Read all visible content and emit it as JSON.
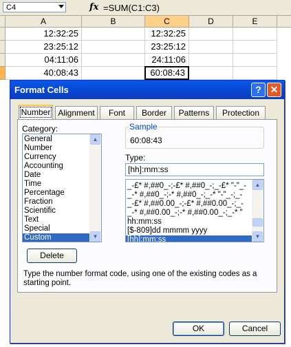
{
  "formula_bar": {
    "name_box": "C4",
    "fx_label": "fx",
    "formula": "=SUM(C1:C3)"
  },
  "sheet": {
    "columns": [
      "A",
      "B",
      "C",
      "D",
      "E"
    ],
    "rows": [
      {
        "A": "12:32:25",
        "C": "12:32:25"
      },
      {
        "A": "23:25:12",
        "C": "23:25:12"
      },
      {
        "A": "04:11:06",
        "C": "24:11:06"
      },
      {
        "A": "40:08:43",
        "C": "60:08:43"
      }
    ]
  },
  "dialog": {
    "title": "Format Cells",
    "help_button": "?",
    "close_button": "✕",
    "tabs": [
      "Number",
      "Alignment",
      "Font",
      "Border",
      "Patterns",
      "Protection"
    ],
    "active_tab": "Number",
    "category_label": "Category:",
    "categories": [
      "General",
      "Number",
      "Currency",
      "Accounting",
      "Date",
      "Time",
      "Percentage",
      "Fraction",
      "Scientific",
      "Text",
      "Special",
      "Custom"
    ],
    "selected_category": "Custom",
    "sample_label": "Sample",
    "sample_value": "60:08:43",
    "type_label": "Type:",
    "type_value": "[hh]:mm:ss",
    "type_list": [
      "_-£* #,##0_-;-£* #,##0_-;_-£* \"-\"_-",
      "_-* #,##0_-;-* #,##0_-;_-* \"-\"_-;_-",
      "_-£* #,##0.00_-;-£* #,##0.00_-;_-",
      "_-* #,##0.00_-;-* #,##0.00_-;_-* \"",
      "hh:mm:ss",
      "[$-809]dd mmmm yyyy",
      "[hh]:mm:ss"
    ],
    "delete_button": "Delete",
    "description": "Type the number format code, using one of the existing codes as a starting point.",
    "ok_button": "OK",
    "cancel_button": "Cancel"
  }
}
